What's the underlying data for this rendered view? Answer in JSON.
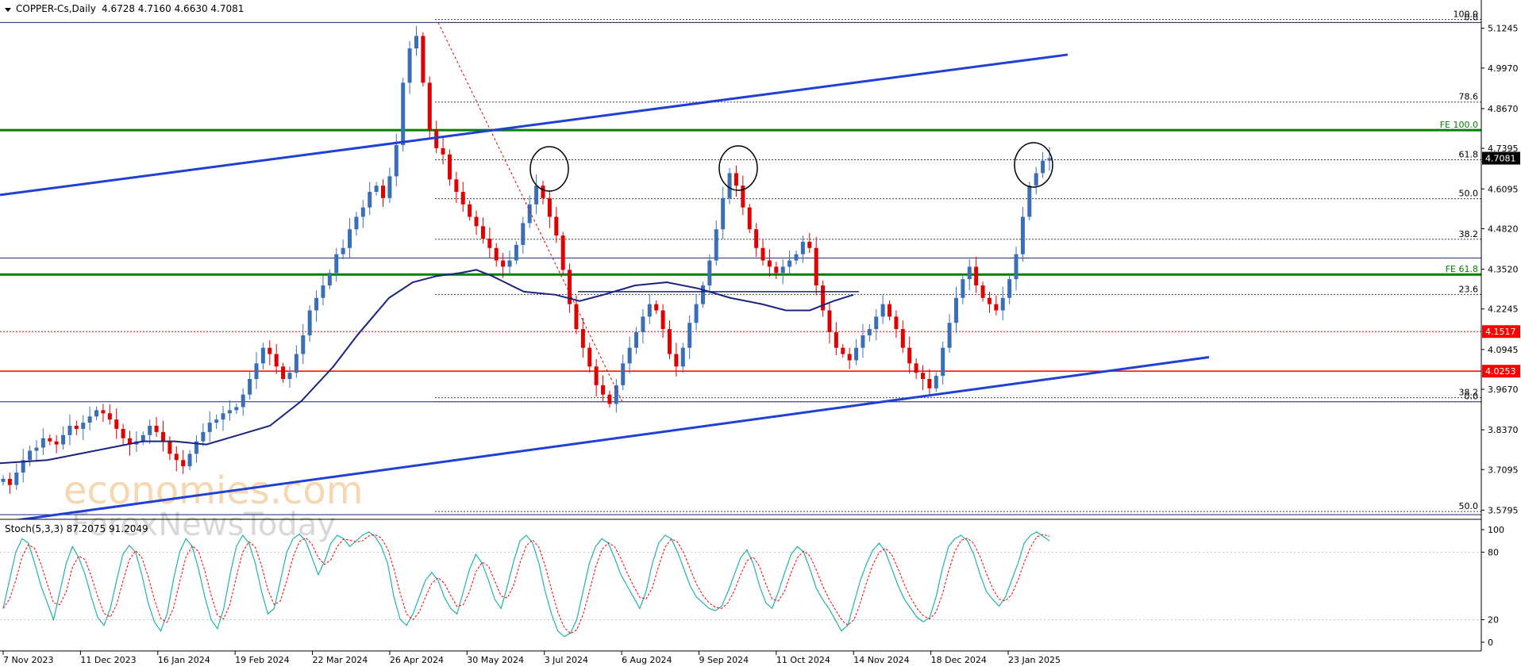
{
  "header": {
    "symbol": "COPPER-Cs,Daily",
    "ohlc": "4.6728 4.7160 4.6630 4.7081"
  },
  "stoch_label": "Stoch(5,3,3) 87.2075 91.2049",
  "watermark": {
    "brand": "economies.com",
    "sub": "ForexNewsToday"
  },
  "colors": {
    "up": "#3a6fb8",
    "down": "#e00000",
    "channel": "#1f3fd6",
    "ma": "#1a237e",
    "fe": "#008000",
    "level_red": "#ff0000",
    "stoch_main": "#20b2aa",
    "stoch_signal": "#ff0000"
  },
  "chart_data": {
    "type": "candlestick",
    "price_axis": {
      "ticks": [
        "5.1245",
        "4.9970",
        "4.8670",
        "4.7395",
        "4.6095",
        "4.4820",
        "4.3520",
        "4.2245",
        "4.0945",
        "3.9670",
        "3.8370",
        "3.7095",
        "3.5795"
      ],
      "range": [
        3.55,
        5.2
      ]
    },
    "x_labels": [
      "7 Nov 2023",
      "11 Dec 2023",
      "16 Jan 2024",
      "19 Feb 2024",
      "22 Mar 2024",
      "26 Apr 2024",
      "30 May 2024",
      "3 Jul 2024",
      "6 Aug 2024",
      "9 Sep 2024",
      "11 Oct 2024",
      "14 Nov 2024",
      "18 Dec 2024",
      "23 Jan 2025"
    ],
    "closes": [
      3.68,
      3.66,
      3.7,
      3.74,
      3.77,
      3.78,
      3.81,
      3.8,
      3.79,
      3.82,
      3.85,
      3.84,
      3.86,
      3.88,
      3.9,
      3.89,
      3.87,
      3.84,
      3.81,
      3.79,
      3.8,
      3.82,
      3.85,
      3.83,
      3.8,
      3.76,
      3.74,
      3.72,
      3.76,
      3.8,
      3.83,
      3.86,
      3.87,
      3.89,
      3.9,
      3.91,
      3.95,
      4.0,
      4.05,
      4.1,
      4.08,
      4.04,
      4.0,
      4.02,
      4.08,
      4.14,
      4.22,
      4.26,
      4.3,
      4.34,
      4.4,
      4.42,
      4.48,
      4.52,
      4.55,
      4.6,
      4.62,
      4.58,
      4.65,
      4.75,
      4.95,
      5.06,
      5.1,
      4.95,
      4.8,
      4.74,
      4.72,
      4.64,
      4.6,
      4.56,
      4.52,
      4.49,
      4.45,
      4.42,
      4.38,
      4.36,
      4.38,
      4.43,
      4.5,
      4.56,
      4.62,
      4.58,
      4.52,
      4.46,
      4.35,
      4.24,
      4.16,
      4.1,
      4.04,
      3.98,
      3.95,
      3.92,
      3.98,
      4.05,
      4.1,
      4.15,
      4.2,
      4.24,
      4.22,
      4.16,
      4.08,
      4.04,
      4.1,
      4.18,
      4.24,
      4.3,
      4.38,
      4.48,
      4.58,
      4.66,
      4.62,
      4.55,
      4.48,
      4.42,
      4.38,
      4.36,
      4.34,
      4.36,
      4.38,
      4.4,
      4.44,
      4.42,
      4.3,
      4.22,
      4.15,
      4.1,
      4.08,
      4.06,
      4.1,
      4.14,
      4.16,
      4.2,
      4.24,
      4.2,
      4.16,
      4.1,
      4.05,
      4.02,
      4.0,
      3.97,
      4.01,
      4.1,
      4.18,
      4.26,
      4.32,
      4.36,
      4.3,
      4.26,
      4.24,
      4.22,
      4.26,
      4.32,
      4.4,
      4.52,
      4.62,
      4.66,
      4.7,
      4.7081
    ],
    "ma_line": [
      [
        0,
        3.73
      ],
      [
        60,
        3.74
      ],
      [
        100,
        3.76
      ],
      [
        140,
        3.78
      ],
      [
        180,
        3.8
      ],
      [
        220,
        3.8
      ],
      [
        260,
        3.79
      ],
      [
        300,
        3.82
      ],
      [
        340,
        3.85
      ],
      [
        380,
        3.93
      ],
      [
        420,
        4.04
      ],
      [
        450,
        4.14
      ],
      [
        470,
        4.2
      ],
      [
        490,
        4.26
      ],
      [
        520,
        4.31
      ],
      [
        550,
        4.33
      ],
      [
        580,
        4.34
      ],
      [
        600,
        4.35
      ],
      [
        620,
        4.33
      ],
      [
        660,
        4.28
      ],
      [
        700,
        4.27
      ],
      [
        730,
        4.25
      ],
      [
        760,
        4.27
      ],
      [
        800,
        4.3
      ],
      [
        840,
        4.31
      ],
      [
        880,
        4.29
      ],
      [
        920,
        4.26
      ],
      [
        960,
        4.24
      ],
      [
        990,
        4.22
      ],
      [
        1020,
        4.22
      ],
      [
        1050,
        4.25
      ],
      [
        1075,
        4.27
      ]
    ],
    "channel_upper": [
      [
        0,
        4.59
      ],
      [
        1345,
        5.04
      ]
    ],
    "channel_lower": [
      [
        0,
        3.54
      ],
      [
        1523,
        4.07
      ]
    ],
    "fe_levels": [
      {
        "label": "FE 100.0",
        "value": 4.798
      },
      {
        "label": "FE 61.8",
        "value": 4.335
      }
    ],
    "fib_levels": [
      {
        "label": "100.0",
        "value": 5.153
      },
      {
        "label": "0.0",
        "value": 5.143
      },
      {
        "label": "78.6",
        "value": 4.888
      },
      {
        "label": "61.8",
        "value": 4.703
      },
      {
        "label": "50.0",
        "value": 4.578
      },
      {
        "label": "38.2",
        "value": 4.448
      },
      {
        "label": "23.6",
        "value": 4.271
      },
      {
        "label": "38.2",
        "value": 3.94
      },
      {
        "label": "0.0",
        "value": 3.927
      },
      {
        "label": "50.0",
        "value": 3.575
      }
    ],
    "price_boxes": [
      {
        "label": "4.7081",
        "value": 4.708,
        "color": "#000000"
      },
      {
        "label": "4.1517",
        "value": 4.152,
        "color": "#ff0000"
      },
      {
        "label": "4.0253",
        "value": 4.025,
        "color": "#ff0000"
      }
    ],
    "stochastic": {
      "range": [
        0,
        100
      ],
      "ticks": [
        "100",
        "80",
        "20",
        "0"
      ],
      "main": [
        30,
        55,
        80,
        92,
        88,
        70,
        50,
        35,
        20,
        45,
        70,
        85,
        75,
        60,
        40,
        22,
        15,
        30,
        55,
        78,
        86,
        80,
        60,
        35,
        18,
        10,
        25,
        55,
        80,
        92,
        85,
        65,
        40,
        20,
        12,
        30,
        60,
        85,
        95,
        88,
        70,
        45,
        25,
        30,
        55,
        80,
        92,
        96,
        90,
        75,
        60,
        72,
        88,
        95,
        92,
        85,
        90,
        95,
        98,
        94,
        85,
        70,
        40,
        20,
        15,
        25,
        40,
        55,
        62,
        55,
        40,
        30,
        25,
        45,
        65,
        78,
        70,
        55,
        38,
        30,
        50,
        72,
        90,
        95,
        88,
        70,
        45,
        25,
        10,
        5,
        8,
        20,
        45,
        70,
        85,
        92,
        88,
        75,
        60,
        50,
        40,
        30,
        45,
        70,
        88,
        95,
        92,
        80,
        65,
        50,
        40,
        35,
        30,
        28,
        32,
        45,
        60,
        75,
        82,
        70,
        50,
        35,
        30,
        45,
        62,
        78,
        85,
        80,
        65,
        48,
        38,
        30,
        20,
        10,
        15,
        35,
        55,
        70,
        82,
        88,
        80,
        65,
        50,
        38,
        30,
        22,
        18,
        22,
        40,
        65,
        85,
        92,
        95,
        90,
        78,
        60,
        45,
        38,
        32,
        40,
        55,
        70,
        88,
        95,
        98,
        94,
        90
      ]
    }
  }
}
